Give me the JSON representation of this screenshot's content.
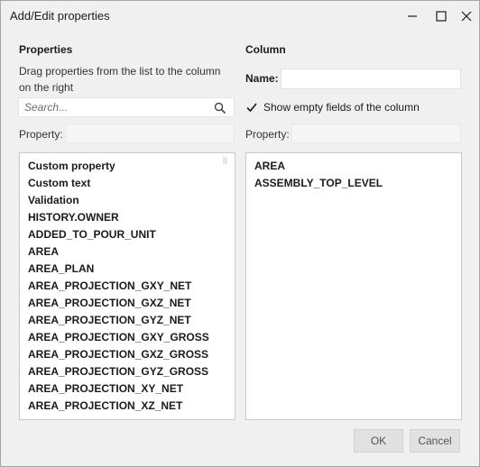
{
  "window": {
    "title": "Add/Edit properties",
    "controls": {
      "minimize_icon": "minimize-icon",
      "maximize_icon": "maximize-icon",
      "close_icon": "close-icon"
    }
  },
  "left": {
    "heading": "Properties",
    "hint": "Drag properties from the list to the column on the right",
    "search": {
      "placeholder": "Search...",
      "value": "",
      "icon": "search-icon"
    },
    "property_label": "Property:",
    "property_value": "",
    "items": [
      "Custom property",
      "Custom text",
      "Validation",
      "HISTORY.OWNER",
      "ADDED_TO_POUR_UNIT",
      "AREA",
      "AREA_PLAN",
      "AREA_PROJECTION_GXY_NET",
      "AREA_PROJECTION_GXZ_NET",
      "AREA_PROJECTION_GYZ_NET",
      "AREA_PROJECTION_GXY_GROSS",
      "AREA_PROJECTION_GXZ_GROSS",
      "AREA_PROJECTION_GYZ_GROSS",
      "AREA_PROJECTION_XY_NET",
      "AREA_PROJECTION_XZ_NET"
    ]
  },
  "right": {
    "heading": "Column",
    "name_label": "Name:",
    "name_value": "",
    "show_empty": {
      "label": "Show empty fields of the column",
      "checked": true
    },
    "property_label": "Property:",
    "property_value": "",
    "items": [
      "AREA",
      "ASSEMBLY_TOP_LEVEL"
    ]
  },
  "buttons": {
    "ok": "OK",
    "cancel": "Cancel"
  },
  "colors": {
    "window_bg": "#f0f0f0",
    "accent": "#0063b1"
  }
}
